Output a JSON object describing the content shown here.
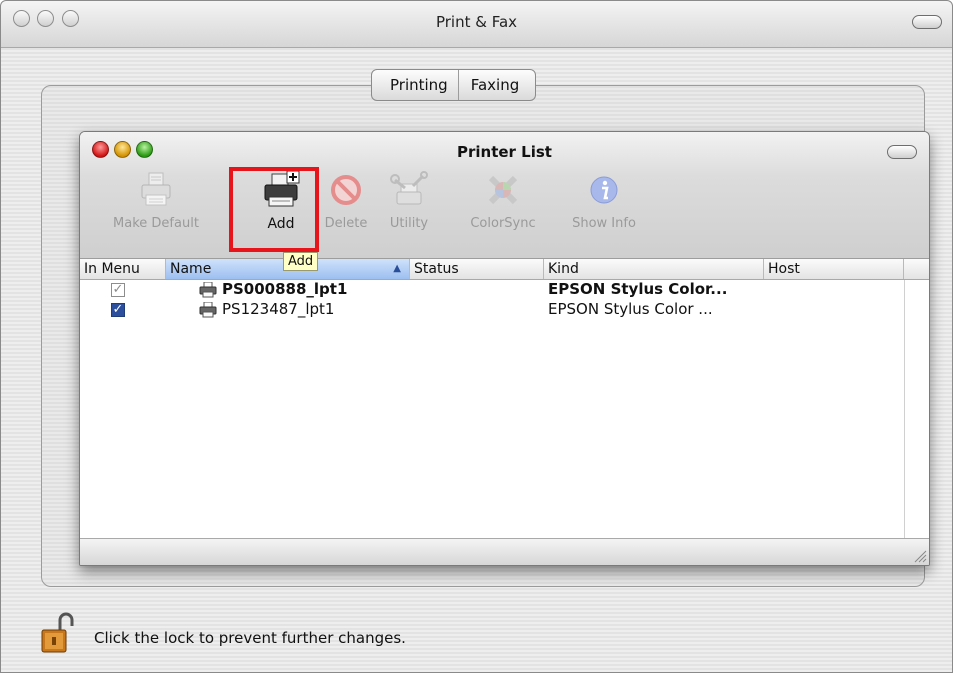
{
  "window": {
    "title": "Print & Fax"
  },
  "tabs": [
    {
      "label": "Printing"
    },
    {
      "label": "Faxing"
    }
  ],
  "printer_list": {
    "title": "Printer List",
    "toolbar": {
      "make_default": "Make Default",
      "add": "Add",
      "delete": "Delete",
      "utility": "Utility",
      "colorsync": "ColorSync",
      "show_info": "Show Info"
    },
    "tooltip": "Add",
    "columns": {
      "in_menu": "In Menu",
      "name": "Name",
      "status": "Status",
      "kind": "Kind",
      "host": "Host"
    },
    "rows": [
      {
        "name": "PS000888_lpt1",
        "status": "",
        "kind": "EPSON Stylus Color...",
        "host": "",
        "in_menu": true,
        "default": true
      },
      {
        "name": "PS123487_lpt1",
        "status": "",
        "kind": "EPSON Stylus Color ...",
        "host": "",
        "in_menu": true,
        "default": false
      }
    ]
  },
  "lock": {
    "text": "Click the lock to prevent further changes."
  },
  "colors": {
    "highlight": "#e8141c",
    "tooltip_bg": "#ffffc6",
    "selected_column": "#9dbff0"
  }
}
